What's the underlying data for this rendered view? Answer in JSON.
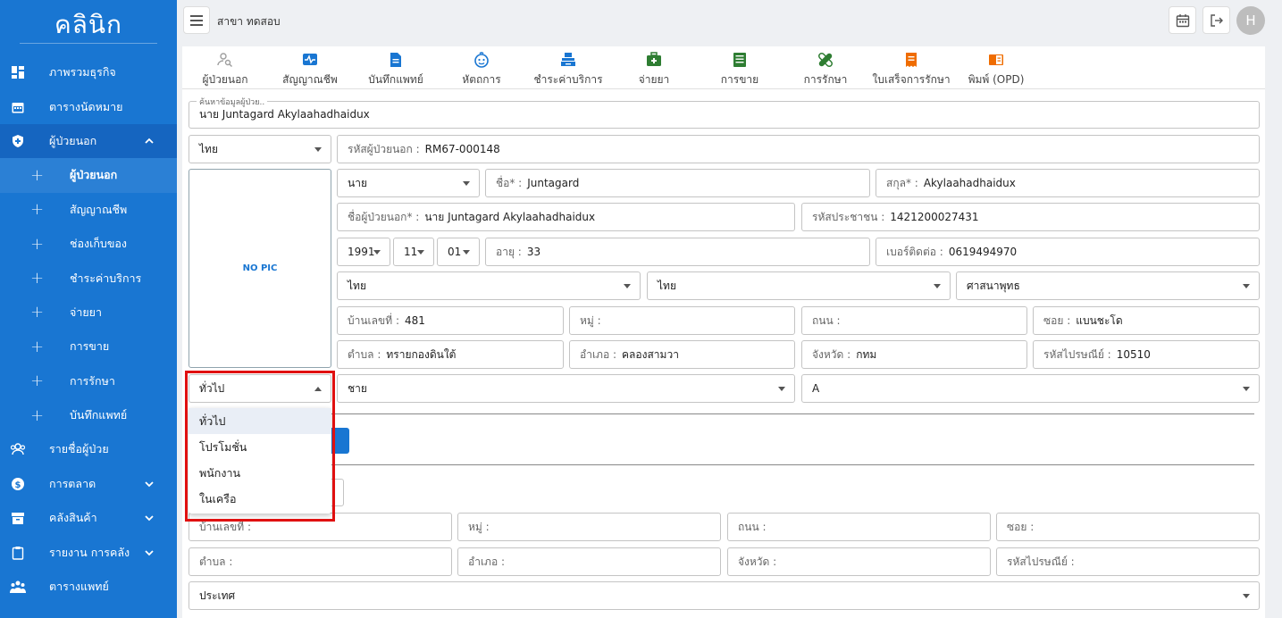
{
  "sidebar": {
    "brand": "คลินิก",
    "items": [
      {
        "label": "ภาพรวมธุรกิจ",
        "icon": "dashboard-icon"
      },
      {
        "label": "ตารางนัดหมาย",
        "icon": "calendar-icon"
      },
      {
        "label": "ผู้ป่วยนอก",
        "icon": "shield-icon",
        "expanded": true
      },
      {
        "label": "ผู้ป่วยนอก",
        "sub": true,
        "active": true
      },
      {
        "label": "สัญญาณชีพ",
        "sub": true
      },
      {
        "label": "ช่องเก็บของ",
        "sub": true
      },
      {
        "label": "ชำระค่าบริการ",
        "sub": true
      },
      {
        "label": "จ่ายยา",
        "sub": true
      },
      {
        "label": "การขาย",
        "sub": true
      },
      {
        "label": "การรักษา",
        "sub": true
      },
      {
        "label": "บันทึกแพทย์",
        "sub": true
      },
      {
        "label": "รายชื่อผู้ป่วย",
        "icon": "patients-icon"
      },
      {
        "label": "การตลาด",
        "icon": "dollar-icon",
        "chevron": true
      },
      {
        "label": "คลังสินค้า",
        "icon": "archive-icon",
        "chevron": true
      },
      {
        "label": "รายงาน การคลัง",
        "icon": "clipboard-icon",
        "chevron": true
      },
      {
        "label": "ตารางแพทย์",
        "icon": "doctors-icon"
      }
    ]
  },
  "topbar": {
    "branch": "สาขา ทดสอบ",
    "avatar_initial": "H"
  },
  "tabs": [
    {
      "label": "ผู้ป่วยนอก",
      "icon": "patient-search-icon",
      "color": "#9e9e9e"
    },
    {
      "label": "สัญญาณชีพ",
      "icon": "pulse-icon",
      "color": "#1976d2"
    },
    {
      "label": "บันทึกแพทย์",
      "icon": "document-icon",
      "color": "#1976d2"
    },
    {
      "label": "หัตถการ",
      "icon": "face-icon",
      "color": "#1976d2"
    },
    {
      "label": "ชำระค่าบริการ",
      "icon": "cashier-icon",
      "color": "#1976d2"
    },
    {
      "label": "จ่ายยา",
      "icon": "medkit-icon",
      "color": "#2e7d32"
    },
    {
      "label": "การขาย",
      "icon": "sheet-icon",
      "color": "#2e7d32"
    },
    {
      "label": "การรักษา",
      "icon": "bandage-icon",
      "color": "#2e7d32"
    },
    {
      "label": "ใบเสร็จการรักษา",
      "icon": "receipt-icon",
      "color": "#ef6c00"
    },
    {
      "label": "พิมพ์ (OPD)",
      "icon": "book-icon",
      "color": "#ef6c00"
    }
  ],
  "form": {
    "search_label": "ค้นหาข้อมูลผู้ป่วย..",
    "search_value": "นาย Juntagard Akylaahadhaidux",
    "nationality": "ไทย",
    "hn_label": "รหัสผู้ป่วยนอก :",
    "hn_value": "RM67-000148",
    "no_pic": "NO PIC",
    "title": "นาย",
    "firstname_label": "ชื่อ* :",
    "firstname_value": "Juntagard",
    "lastname_label": "สกุล* :",
    "lastname_value": "Akylaahadhaidux",
    "fullname_label": "ชื่อผู้ป่วยนอก* :",
    "fullname_value": "นาย Juntagard Akylaahadhaidux",
    "idcard_label": "รหัสประชาชน :",
    "idcard_value": "1421200027431",
    "birth_year": "1991",
    "birth_month": "11",
    "birth_day": "01",
    "age_label": "อายุ :",
    "age_value": "33",
    "phone_label": "เบอร์ติดต่อ :",
    "phone_value": "0619494970",
    "race": "ไทย",
    "nation": "ไทย",
    "religion": "ศาสนาพุทธ",
    "house_label": "บ้านเลขที่ :",
    "house_value": "481",
    "moo_label": "หมู่ :",
    "road_label": "ถนน :",
    "soi_label": "ซอย :",
    "soi_value": "แบนชะโด",
    "tambon_label": "ตำบล :",
    "tambon_value": "ทรายกองดินใต้",
    "amphoe_label": "อำเภอ :",
    "amphoe_value": "คลองสามวา",
    "province_label": "จังหวัด :",
    "province_value": "กทม",
    "postal_label": "รหัสไปรษณีย์ :",
    "postal_value": "10510",
    "patient_type": "ทั่วไป",
    "gender": "ชาย",
    "blood": "A",
    "country_label": "ประเทศ"
  },
  "dropdown": {
    "options": [
      "ทั่วไป",
      "โปรโมชั่น",
      "พนักงาน",
      "ในเครือ"
    ],
    "selected_index": 0
  }
}
